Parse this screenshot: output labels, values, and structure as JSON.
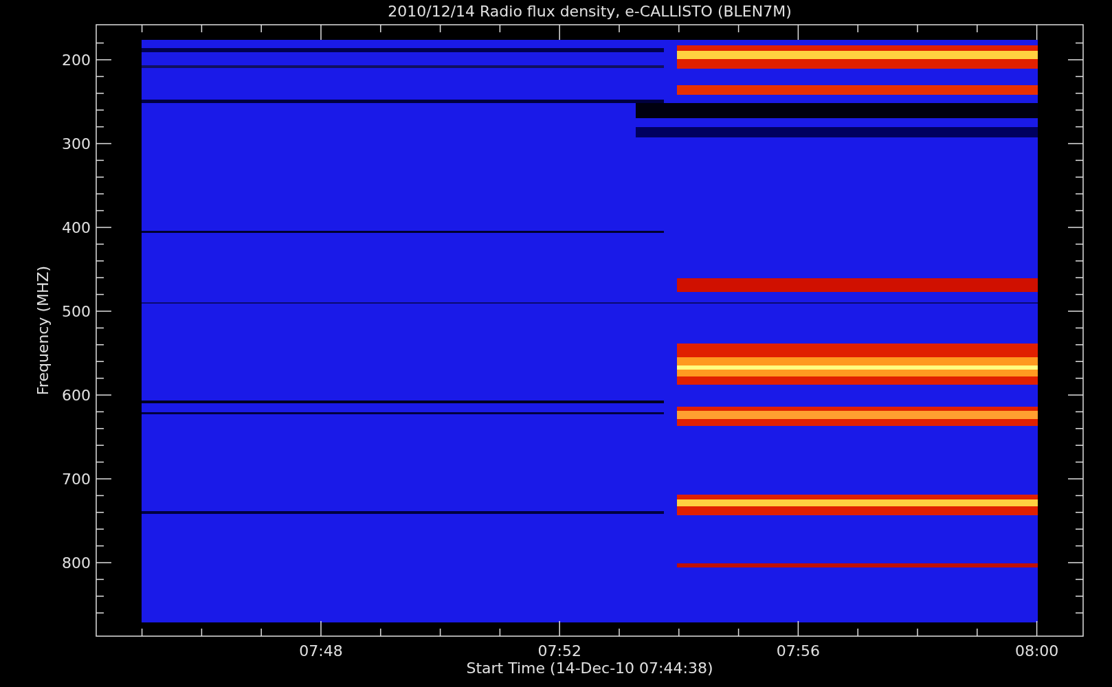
{
  "title": "2010/12/14  Radio flux density, e-CALLISTO (BLEN7M)",
  "ylabel": "Frequency (MHZ)",
  "xlabel": "Start Time (14-Dec-10 07:44:38)",
  "y_ticks": [
    "200",
    "300",
    "400",
    "500",
    "600",
    "700",
    "800"
  ],
  "x_ticks": [
    "07:48",
    "07:52",
    "07:56",
    "08:00"
  ]
}
